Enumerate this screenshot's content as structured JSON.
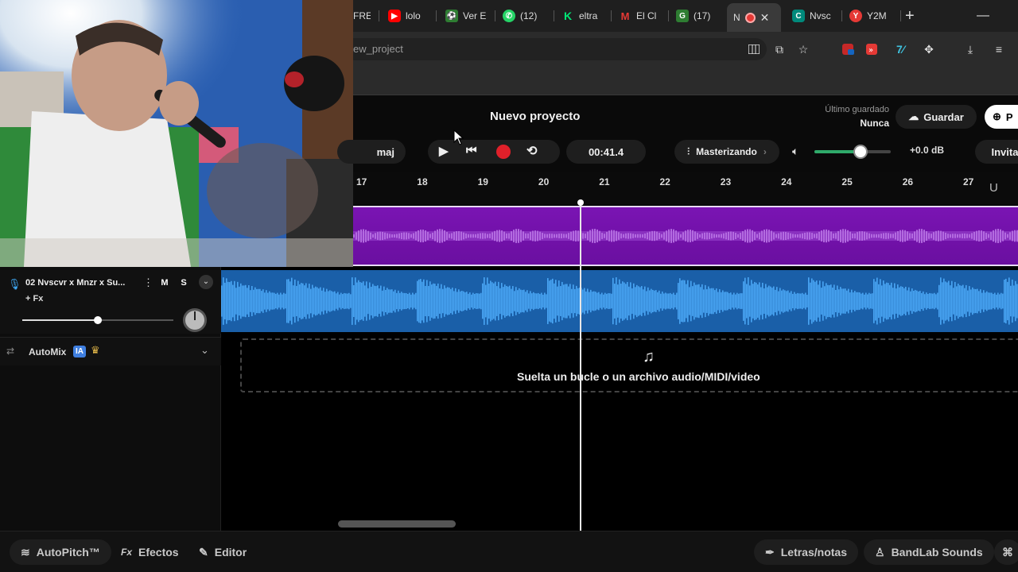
{
  "browser": {
    "tabs": [
      {
        "label": "FREI",
        "icon_color": "#444444",
        "icon_glyph": ""
      },
      {
        "label": "lolo",
        "icon_color": "#ff0000",
        "icon_glyph": "▶"
      },
      {
        "label": "Ver E",
        "icon_color": "#2e7d32",
        "icon_glyph": "⚽"
      },
      {
        "label": "(12)",
        "icon_color": "#25d366",
        "icon_glyph": "✆"
      },
      {
        "label": "eltra",
        "icon_color": "#00c853",
        "icon_glyph": "K"
      },
      {
        "label": "El Cl",
        "icon_color": "#c62828",
        "icon_glyph": "M"
      },
      {
        "label": "(17)",
        "icon_color": "#2e7d32",
        "icon_glyph": "G"
      },
      {
        "label": "N",
        "icon_color": "#333333",
        "icon_glyph": ""
      },
      {
        "label": "Nvsc",
        "icon_color": "#00897b",
        "icon_glyph": "C"
      },
      {
        "label": "Y2M",
        "icon_color": "#e53935",
        "icon_glyph": "Y"
      }
    ],
    "url": "ew_project"
  },
  "project": {
    "title": "Nuevo proyecto",
    "last_saved_label": "Último guardado",
    "last_saved_value": "Nunca",
    "save_label": "Guardar",
    "publish_label": "P",
    "invite_label": "Invitar",
    "key_label": "maj",
    "time": "00:41.4",
    "mastering_label": "Masterizando",
    "volume_db": "+0.0 dB",
    "volume_level": 0.6
  },
  "ruler": {
    "ticks": [
      "17",
      "18",
      "19",
      "20",
      "21",
      "22",
      "23",
      "24",
      "25",
      "26",
      "27"
    ]
  },
  "tracks": [
    {
      "name": "02  Nvscvr x Mnzr x Su...",
      "fx_label": "+ Fx",
      "mute": "M",
      "solo": "S",
      "volume": 0.5
    }
  ],
  "automix": {
    "label": "AutoMix",
    "badge": "IA"
  },
  "dropzone": {
    "text": "Suelta un bucle o un archivo audio/MIDI/video"
  },
  "bottombar": {
    "autopitch": "AutoPitch™",
    "effects": "Efectos",
    "editor": "Editor",
    "lyrics": "Letras/notas",
    "sounds": "BandLab Sounds"
  },
  "colors": {
    "vocal_clip": "#7a14b3",
    "beat_clip": "#1a5fa8",
    "record": "#e0202a",
    "accent": "#3fa9f5"
  }
}
